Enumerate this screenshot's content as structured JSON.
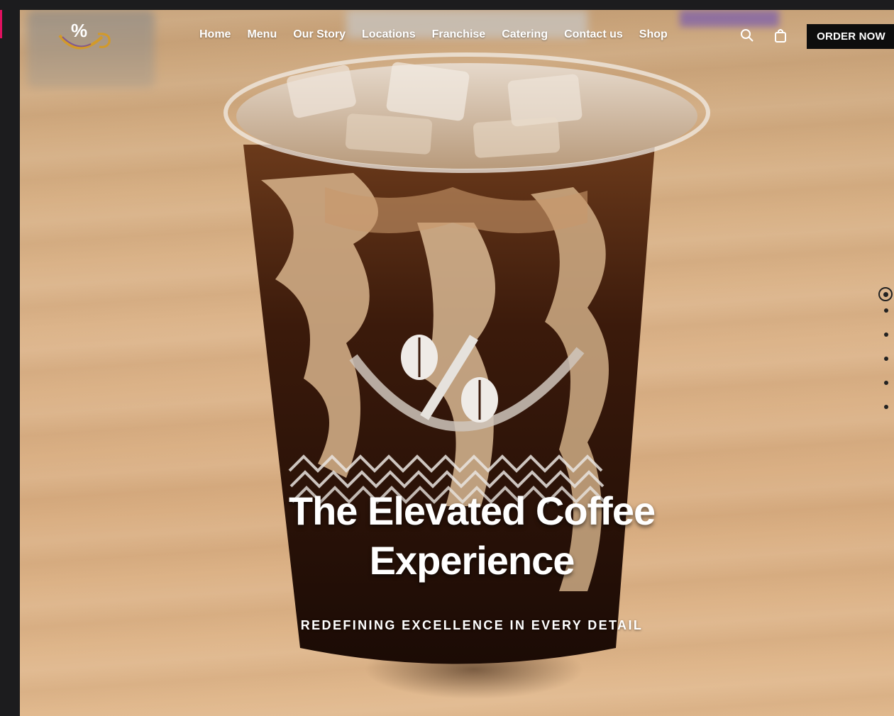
{
  "nav": {
    "logo_icon": "percent-smile-logo",
    "links": [
      "Home",
      "Menu",
      "Our Story",
      "Locations",
      "Franchise",
      "Catering",
      "Contact us",
      "Shop"
    ],
    "search_icon": "search-icon",
    "cart_icon": "shopping-bag-icon",
    "order_button": "ORDER NOW"
  },
  "hero": {
    "title_line1": "The Elevated Coffee",
    "title_line2": "Experience",
    "subtitle": "REDEFINING EXCELLENCE IN EVERY DETAIL",
    "slides_count": 6,
    "active_slide": 1
  },
  "colors": {
    "accent": "#e0115f",
    "button_bg": "#0d0d0d",
    "logo_gold": "#d29a2a",
    "logo_purple": "#6b3fa0"
  }
}
